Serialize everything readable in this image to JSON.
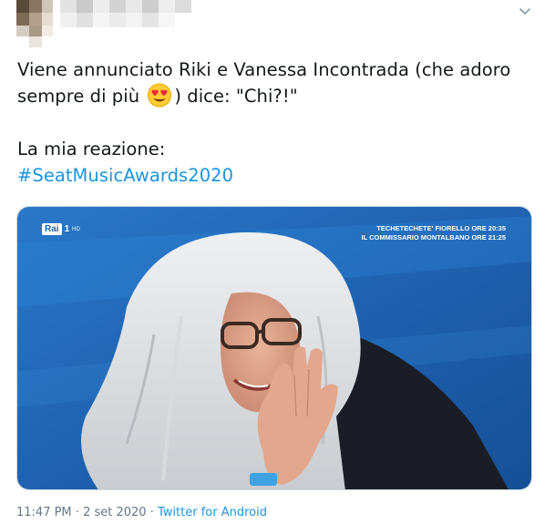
{
  "tweet": {
    "lines": [
      {
        "before": "Viene annunciato Riki e Vanessa Incontrada (che adoro"
      },
      {
        "before": "sempre di più ",
        "emoji": "heart-eyes-emoji",
        "after": ") dice: \"Chi?!\""
      },
      {
        "before": ""
      },
      {
        "before": "La mia reazione:"
      }
    ],
    "hashtag": "#SeatMusicAwards2020"
  },
  "media": {
    "channel_logo": "Rai",
    "channel_number": "1",
    "channel_hd": "HD",
    "ticker_line1": "TECHETECHETE' FIORELLO ORE 20:35",
    "ticker_line2": "IL COMMISSARIO MONTALBANO ORE 21:25"
  },
  "meta": {
    "time": "11:47 PM",
    "separator": "·",
    "date": "2 set 2020",
    "source": "Twitter for Android"
  },
  "colors": {
    "link": "#1b95e0",
    "text": "#14171a",
    "muted": "#657786",
    "studio_blue": "#1f63b3"
  },
  "icons": {
    "menu": "chevron-down-icon",
    "emoji": "heart-eyes-emoji"
  }
}
